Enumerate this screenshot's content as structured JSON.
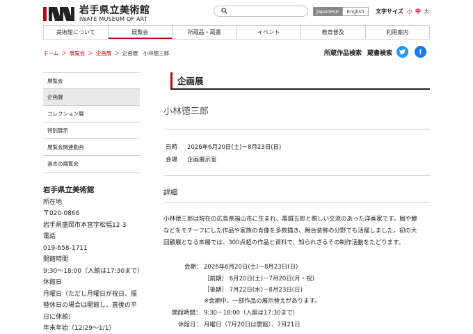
{
  "header": {
    "logo_ja": "岩手県立美術館",
    "logo_en": "IWATE MUSEUM OF ART",
    "lang_ja": "Japanese",
    "lang_en": "English",
    "font_size_label": "文字サイズ",
    "font_size_small": "小",
    "font_size_medium": "中",
    "font_size_large": "大"
  },
  "nav": {
    "items": [
      "美術館について",
      "展覧会",
      "所蔵品・蔵書",
      "イベント",
      "教育普及",
      "利用案内"
    ],
    "active_index": 1
  },
  "breadcrumb": {
    "home": "ホーム",
    "sep": "＞",
    "exhibitions": "展覧会",
    "special": "企画展",
    "current": "企画展　小林徳三郎"
  },
  "utility": {
    "collection_search": "所蔵作品検索",
    "library_search": "蔵書検索",
    "twitter_icon": "twitter-icon",
    "facebook_icon": "facebook-icon"
  },
  "sidebar": {
    "items": [
      "展覧会",
      "企画展",
      "コレクション展",
      "特別展示",
      "展覧会関連動画",
      "過去の展覧会"
    ],
    "active_index": 1,
    "info": {
      "name": "岩手県立美術館",
      "address_label": "所在地",
      "postal": "〒020-0866",
      "address": "岩手県盛岡市本宮字松幅12-3",
      "phone_label": "電話",
      "phone": "019-658-1711",
      "hours_label": "開館時間",
      "hours": "9:30～18:00（入館は17:30まで）",
      "closed_label": "休館日",
      "closed_1": "月曜日（ただし月曜日が祝日、振",
      "closed_2": "替休日の場合は開館し、直後の平",
      "closed_3": "日に休館）",
      "closed_4": "年末年始（12/29～1/1）"
    }
  },
  "main": {
    "heading": "企画展",
    "title": "小林徳三郎",
    "date_label": "日時",
    "date_value": "2026年6月20日(土)－8月23日(日)",
    "venue_label": "会場",
    "venue_value": "企画展示室",
    "detail_heading": "詳細",
    "body_1": "小林徳三郎は現在の広島県福山市に生まれ、萬鐵五郎と親しい交流のあった洋画家です。鰯や鯵",
    "body_2": "などをモチーフにした作品や家族の肖像を多数描き、舞台装飾の分野でも活躍しました。初の大",
    "body_3": "回顧展となる本展では、300点超の作品と資料で、知られざるその制作活動をたどります。",
    "detail": {
      "period_label": "会期：",
      "period_value": "2026年6月20日(土)－8月23日(日)",
      "first": "［前期］ 6月20日(土)－7月20日(月・祝)",
      "second": "［後期］ 7月22日(水)－8月23日(日)",
      "note": "※会期中、一部作品の展示替えがあります。",
      "hours_label": "開館時間：",
      "hours_value": "9:30－18:00（入館は17:30まで）",
      "closed_label": "休館日：",
      "closed_value": "月曜日（7月20日は開館）、7月21日"
    }
  }
}
